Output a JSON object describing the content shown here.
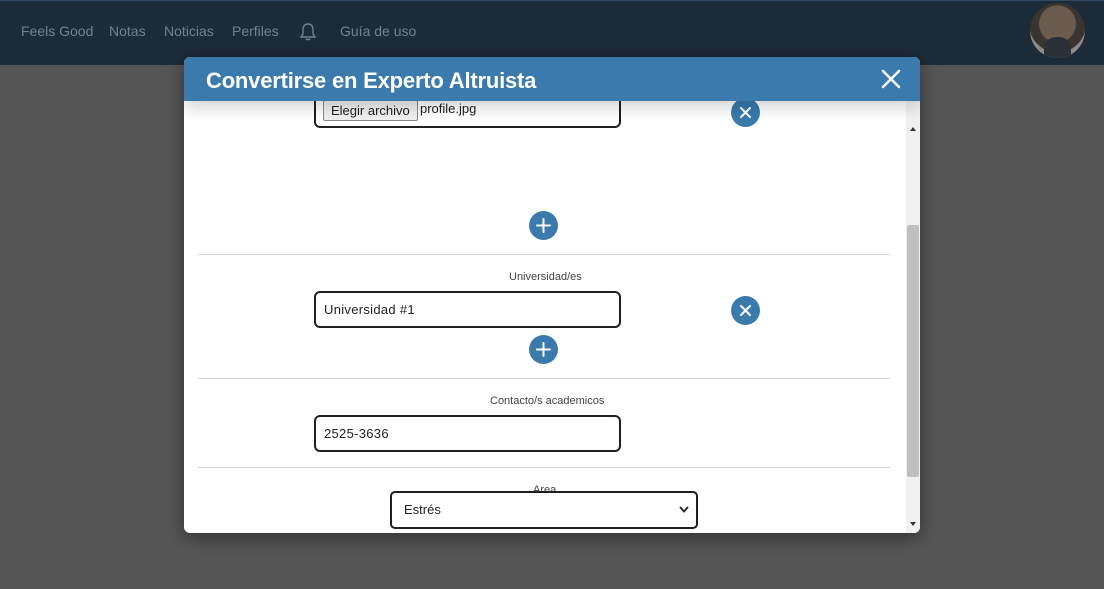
{
  "navbar": {
    "items": [
      "Feels Good",
      "Notas",
      "Noticias",
      "Perfiles",
      "Guía de uso"
    ],
    "bell_icon": "bell-icon",
    "avatar_icon": "user-avatar"
  },
  "modal": {
    "title": "Convertirse en Experto Altruista",
    "close_icon": "close-icon",
    "header_color": "#3a7aad",
    "file_field": {
      "button_label": "Elegir archivo",
      "file_name": "profile.jpg"
    },
    "universities": {
      "label": "Universidad/es",
      "value": "Universidad #1"
    },
    "contacts": {
      "label": "Contacto/s academicos",
      "value": "2525-3636"
    },
    "area": {
      "label": "Area",
      "selected": "Estrés"
    }
  }
}
